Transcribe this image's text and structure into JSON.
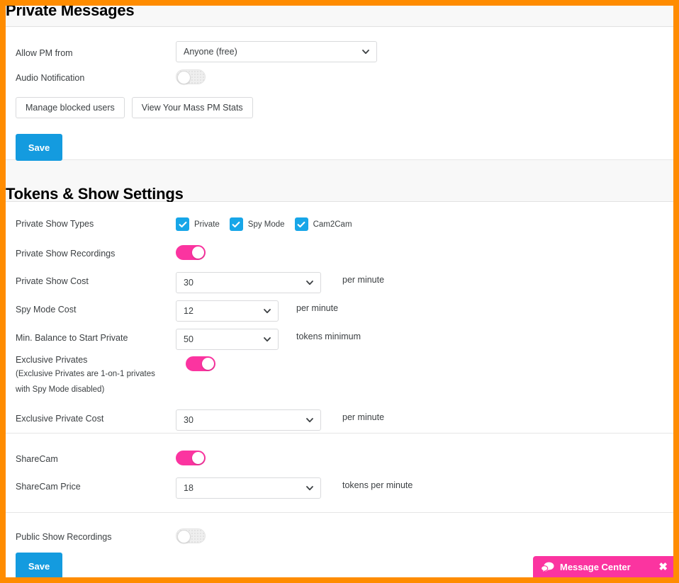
{
  "theme": {
    "frame_color": "#FF8C00",
    "accent_blue": "#149BDF",
    "accent_pink": "#FB34A0",
    "header_bg": "#F8F8F8"
  },
  "private_messages": {
    "title": "Private Messages",
    "allow_pm_label": "Allow PM from",
    "allow_pm_value": "Anyone (free)",
    "audio_notification_label": "Audio Notification",
    "audio_notification_state": "off",
    "manage_blocked_label": "Manage blocked users",
    "mass_pm_stats_label": "View Your Mass PM Stats",
    "save_label": "Save"
  },
  "tokens_show": {
    "title": "Tokens & Show Settings",
    "private_show_types_label": "Private Show Types",
    "show_types": [
      {
        "label": "Private",
        "checked": true
      },
      {
        "label": "Spy Mode",
        "checked": true
      },
      {
        "label": "Cam2Cam",
        "checked": true
      }
    ],
    "private_show_recordings_label": "Private Show Recordings",
    "private_show_recordings_state": "on",
    "private_show_cost_label": "Private Show Cost",
    "private_show_cost_value": "30",
    "private_show_cost_suffix": "per minute",
    "spy_mode_cost_label": "Spy Mode Cost",
    "spy_mode_cost_value": "12",
    "spy_mode_cost_suffix": "per minute",
    "min_balance_label": "Min. Balance to Start Private",
    "min_balance_value": "50",
    "min_balance_suffix": "tokens minimum",
    "exclusive_privates_label": "Exclusive Privates",
    "exclusive_privates_note": "(Exclusive Privates are 1-on-1 privates with Spy Mode disabled)",
    "exclusive_privates_state": "on",
    "exclusive_private_cost_label": "Exclusive Private Cost",
    "exclusive_private_cost_value": "30",
    "exclusive_private_cost_suffix": "per minute",
    "sharecam_label": "ShareCam",
    "sharecam_state": "on",
    "sharecam_price_label": "ShareCam Price",
    "sharecam_price_value": "18",
    "sharecam_price_suffix": "tokens per minute",
    "public_show_recordings_label": "Public Show Recordings",
    "public_show_recordings_state": "off",
    "save_label": "Save"
  },
  "message_center": {
    "title": "Message Center",
    "close_label": "✖"
  }
}
